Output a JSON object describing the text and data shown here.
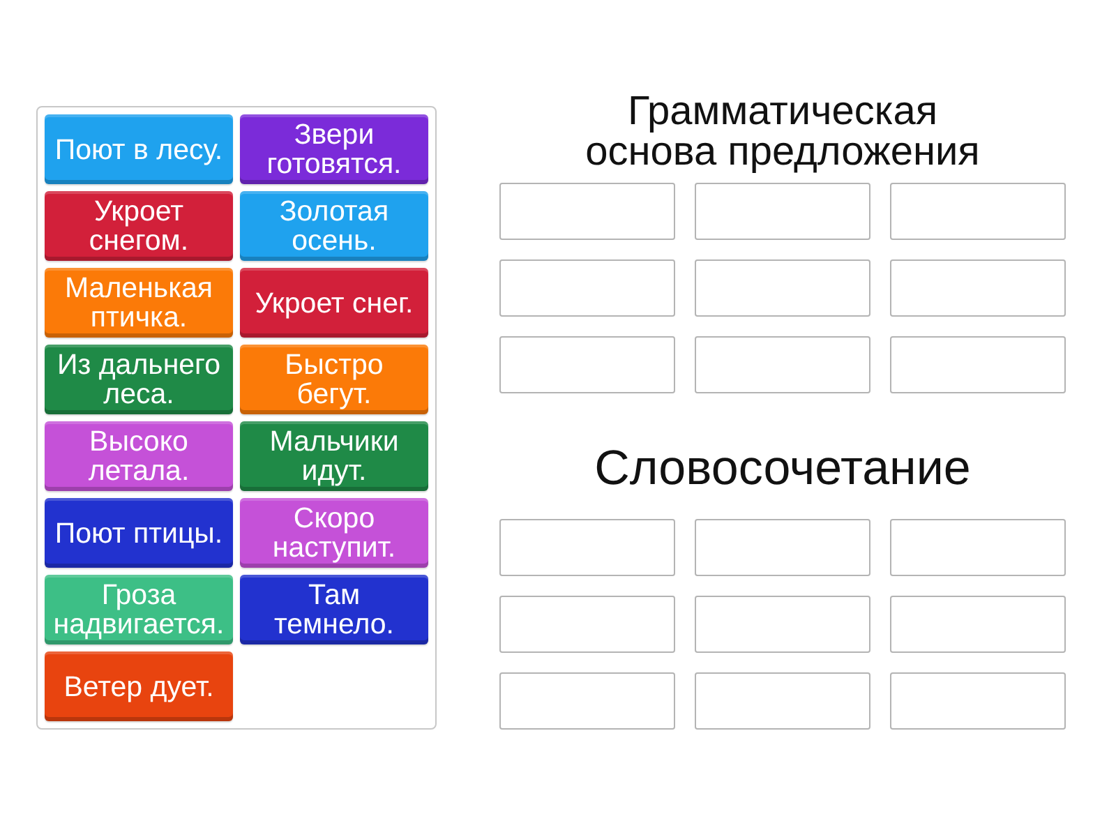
{
  "tiles": [
    {
      "text": "Поют в лесу.",
      "color": "#1fa2ee"
    },
    {
      "text": "Звери готовятся.",
      "color": "#7b2bd9"
    },
    {
      "text": "Укроет снегом.",
      "color": "#d2203a"
    },
    {
      "text": "Золотая осень.",
      "color": "#1fa2ee"
    },
    {
      "text": "Маленькая птичка.",
      "color": "#fb7a08"
    },
    {
      "text": "Укроет снег.",
      "color": "#d2203a"
    },
    {
      "text": "Из дальнего леса.",
      "color": "#1f8a47"
    },
    {
      "text": "Быстро бегут.",
      "color": "#fb7a08"
    },
    {
      "text": "Высоко летала.",
      "color": "#c551d8"
    },
    {
      "text": "Мальчики идут.",
      "color": "#1f8a47"
    },
    {
      "text": "Поют птицы.",
      "color": "#2232cf"
    },
    {
      "text": "Скоро наступит.",
      "color": "#c551d8"
    },
    {
      "text": "Гроза надвигается.",
      "color": "#3dbf86"
    },
    {
      "text": "Там темнело.",
      "color": "#2232cf"
    },
    {
      "text": "Ветер дует.",
      "color": "#e8440f"
    }
  ],
  "groups": [
    {
      "title": "Грамматическая основа предложения",
      "slots": [
        {
          "kind": "empty"
        },
        {
          "kind": "empty"
        },
        {
          "kind": "empty"
        },
        {
          "kind": "empty"
        },
        {
          "kind": "empty"
        },
        {
          "kind": "empty"
        },
        {
          "kind": "empty"
        },
        {
          "kind": "empty"
        },
        {
          "kind": "empty"
        }
      ]
    },
    {
      "title": "Словосочетание",
      "slots": [
        {
          "kind": "empty"
        },
        {
          "kind": "empty"
        },
        {
          "kind": "empty"
        },
        {
          "kind": "empty"
        },
        {
          "kind": "empty"
        },
        {
          "kind": "empty"
        },
        {
          "kind": "empty"
        },
        {
          "kind": "empty"
        },
        {
          "kind": "empty"
        }
      ]
    }
  ]
}
